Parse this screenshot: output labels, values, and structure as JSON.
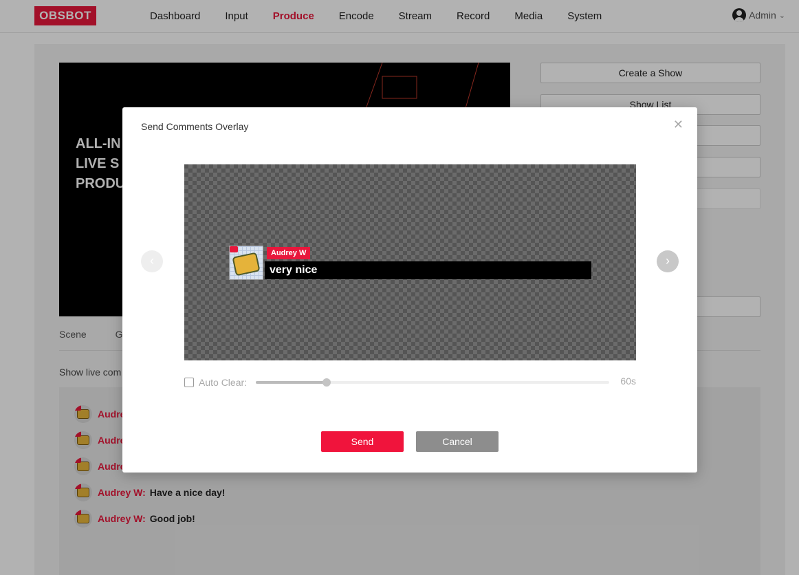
{
  "brand": {
    "logo_text": "OBSBOT",
    "accent_color": "#e8173c"
  },
  "nav": {
    "items": [
      {
        "label": "Dashboard"
      },
      {
        "label": "Input"
      },
      {
        "label": "Produce",
        "active": true
      },
      {
        "label": "Encode"
      },
      {
        "label": "Stream"
      },
      {
        "label": "Record"
      },
      {
        "label": "Media"
      },
      {
        "label": "System"
      }
    ],
    "user": {
      "label": "Admin",
      "icon": "user-avatar-icon",
      "dropdown_icon": "chevron-down-icon"
    }
  },
  "background_page": {
    "preview_text": "ALL-IN\nLIVE S\nPRODU",
    "right_buttons": [
      {
        "label": "Create a Show"
      },
      {
        "label": "Show List"
      }
    ],
    "tabs": [
      "Scene",
      "Gl"
    ],
    "live_comments_label": "Show live com",
    "comments": [
      {
        "name": "Audre",
        "text": ""
      },
      {
        "name": "Audre",
        "text": ""
      },
      {
        "name": "Audre",
        "text": ""
      },
      {
        "name": "Audrey W:",
        "text": "Have a nice day!"
      },
      {
        "name": "Audrey W:",
        "text": "Good job!"
      }
    ]
  },
  "modal": {
    "title": "Send Comments Overlay",
    "close_icon": "close-icon",
    "prev_icon": "chevron-left-icon",
    "next_icon": "chevron-right-icon",
    "overlay": {
      "author": "Audrey W",
      "comment": "very nice"
    },
    "auto_clear": {
      "label": "Auto Clear:",
      "checked": false,
      "value_fraction": 0.2,
      "value_text": "60s"
    },
    "send_label": "Send",
    "cancel_label": "Cancel"
  }
}
